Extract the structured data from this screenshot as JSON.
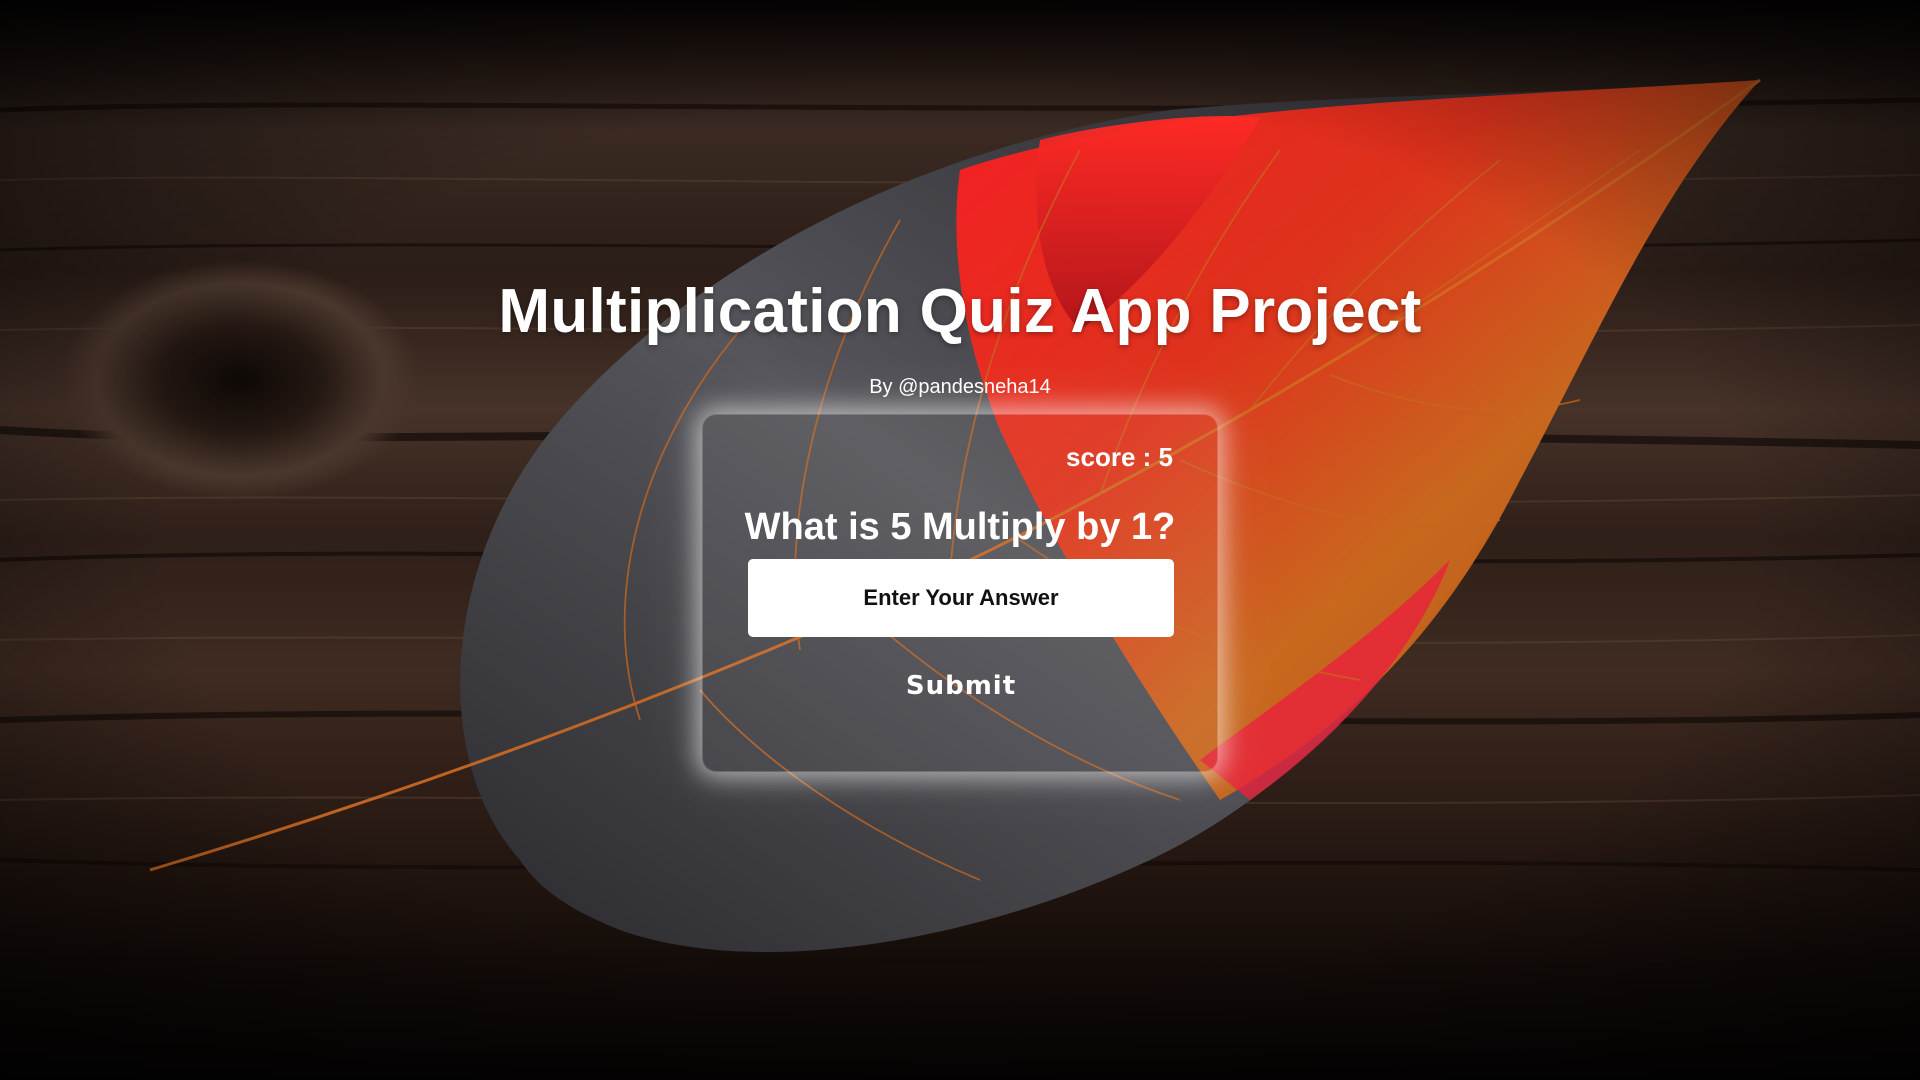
{
  "header": {
    "title": "Multiplication Quiz App Project",
    "byline": "By @pandesneha14"
  },
  "quiz": {
    "score_label": "score : ",
    "score_value": "5",
    "question": "What is 5 Multiply by 1?",
    "answer_value": "",
    "answer_placeholder": "Enter Your Answer",
    "submit_label": "Submit"
  },
  "colors": {
    "text": "#ffffff",
    "input_background": "#ffffff",
    "background_dark": "#0d0807",
    "leaf_red": "#e8201f",
    "leaf_orange": "#d4661a",
    "leaf_gray": "#4a4a4e"
  },
  "background": {
    "description_icon": "autumn-leaf-on-wood"
  }
}
